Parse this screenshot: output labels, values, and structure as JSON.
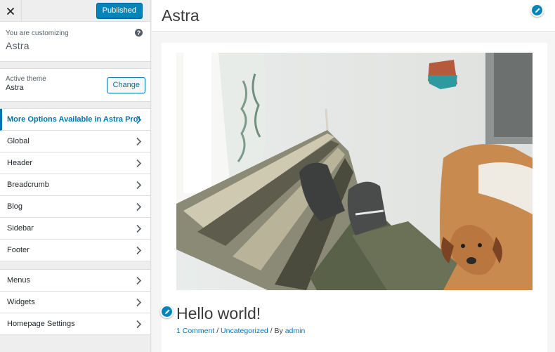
{
  "sidebar": {
    "publish_label": "Published",
    "customizing_label": "You are customizing",
    "customizing_theme": "Astra",
    "help_glyph": "?",
    "active_theme_label": "Active theme",
    "active_theme_name": "Astra",
    "change_label": "Change",
    "pro_item": "More Options Available in Astra Pro!",
    "items": [
      "Global",
      "Header",
      "Breadcrumb",
      "Blog",
      "Sidebar",
      "Footer"
    ],
    "items2": [
      "Menus",
      "Widgets",
      "Homepage Settings"
    ]
  },
  "preview": {
    "site_title": "Astra",
    "post_title": "Hello world!",
    "meta": {
      "comments": "1 Comment",
      "sep1": " / ",
      "category": "Uncategorized",
      "sep2": " / By ",
      "author": "admin"
    }
  },
  "colors": {
    "primary": "#0085ba",
    "link": "#0073aa"
  }
}
